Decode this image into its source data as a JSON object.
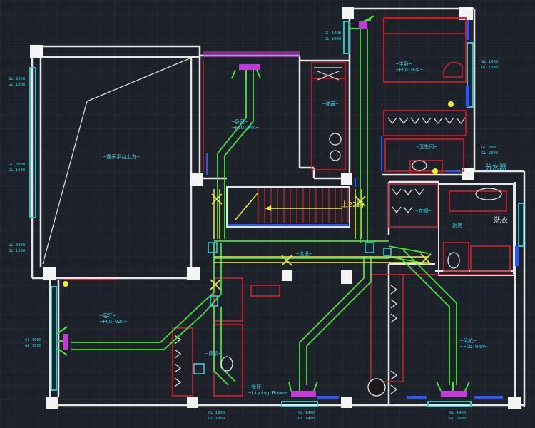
{
  "drawing": {
    "background": "#1d2129",
    "grid_color": "#2b313c",
    "wall_color": "#e6e6e6",
    "partition_color": "#d41f2a",
    "duct_color": "#45e33a",
    "duct_yellow": "#f2ef33",
    "cyan_color": "#30d9e6",
    "magenta_color": "#c33bd6",
    "blue_color": "#2a55ff",
    "window_color": "#2fc0c0"
  },
  "labels": {
    "terrace_note": "~露天平台上方~",
    "stair_label": "上22踏",
    "living_note": "~客厅~",
    "living_sub": "~FCU-02A~",
    "dining_note": "~餐厅~",
    "dining_sub": "~Living Room~",
    "master_bed_note": "~主卧~",
    "master_bed_sub": "~FCU-02A~",
    "bed2_note": "~卧室~",
    "bed2_sub": "~FCU-04A~",
    "bath_label": "~卫生间~",
    "laundry_label": "洗衣",
    "cloak_label": "~衣帽~",
    "storage_label": "~储藏~",
    "corridor_label": "~走道~",
    "water_sep_label": "分水器",
    "kitchen_label": "~厨房~",
    "fan_label": "~风机~"
  },
  "dim_notes": {
    "top_left_1": "GL 1600",
    "top_left_2": "GL 1000",
    "left_1_a": "GL 2000",
    "left_1_b": "GL 1800",
    "left_2_a": "GL 2000",
    "left_2_b": "GL 1500",
    "left_3_a": "GL 2000",
    "left_3_b": "GL 1500",
    "bl_1": "GL 1600",
    "bl_2": "GL 1500",
    "right_1": "GL 1400",
    "right_2": "GL 1000",
    "right_mid_1": "GL 800",
    "right_mid_2": "GL 2000",
    "bottom_1": "GL 1800",
    "bottom_2": "GL 1800",
    "bottom_3": "GL 1400",
    "bottom_4": "GL 1400",
    "bottom_5": "GL 1400",
    "bottom_6": "GL 2000"
  }
}
